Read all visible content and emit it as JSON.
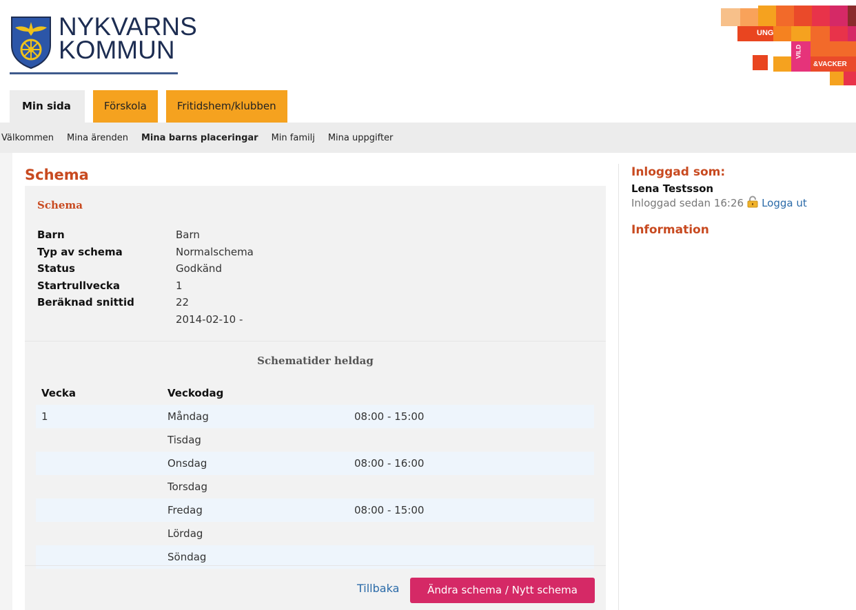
{
  "brand": {
    "logo_line1": "NYKVARNS",
    "logo_line2": "KOMMUN",
    "campaign_word1": "UNG",
    "campaign_word2": "VILD",
    "campaign_word3": "&VACKER",
    "colors": {
      "orange": "#f5a21f",
      "accent_red": "#c84a20",
      "pink": "#d52966",
      "link": "#2a6aa8"
    }
  },
  "tabs": [
    {
      "label": "Min sida",
      "active": true
    },
    {
      "label": "Förskola",
      "active": false
    },
    {
      "label": "Fritidshem/klubben",
      "active": false
    }
  ],
  "subnav": [
    {
      "label": "Välkommen"
    },
    {
      "label": "Mina ärenden"
    },
    {
      "label": "Mina barns placeringar",
      "active": true
    },
    {
      "label": "Min familj"
    },
    {
      "label": "Mina uppgifter"
    }
  ],
  "main": {
    "page_title": "Schema",
    "panel_title": "Schema",
    "fields": [
      {
        "label": "Barn",
        "value": "Barn"
      },
      {
        "label": "Typ av schema",
        "value": "Normalschema"
      },
      {
        "label": "Status",
        "value": "Godkänd"
      },
      {
        "label": "Startrullvecka",
        "value": "1"
      },
      {
        "label": "Beräknad snittid",
        "value": "22"
      },
      {
        "label": "",
        "value": "2014-02-10 -"
      }
    ],
    "schedule": {
      "title": "Schematider heldag",
      "headers": [
        "Vecka",
        "Veckodag",
        ""
      ],
      "rows": [
        {
          "week": "1",
          "day": "Måndag",
          "time": "08:00 - 15:00"
        },
        {
          "week": "",
          "day": "Tisdag",
          "time": ""
        },
        {
          "week": "",
          "day": "Onsdag",
          "time": "08:00 - 16:00"
        },
        {
          "week": "",
          "day": "Torsdag",
          "time": ""
        },
        {
          "week": "",
          "day": "Fredag",
          "time": "08:00 - 15:00"
        },
        {
          "week": "",
          "day": "Lördag",
          "time": ""
        },
        {
          "week": "",
          "day": "Söndag",
          "time": ""
        }
      ]
    },
    "back_label": "Tillbaka",
    "edit_label": "Ändra schema / Nytt schema"
  },
  "sidebar": {
    "logged_in_heading": "Inloggad som:",
    "user_name": "Lena Testsson",
    "logged_in_since": "Inloggad sedan 16:26",
    "lock_icon": "lock-icon",
    "logout_label": "Logga ut",
    "info_heading": "Information"
  }
}
